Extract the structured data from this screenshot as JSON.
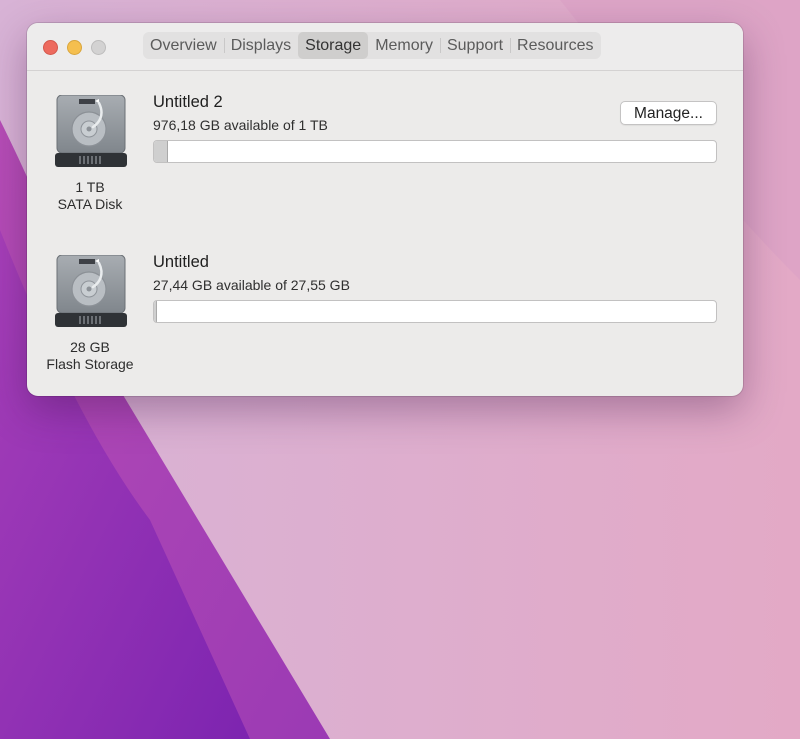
{
  "tabs": [
    {
      "label": "Overview",
      "active": false
    },
    {
      "label": "Displays",
      "active": false
    },
    {
      "label": "Storage",
      "active": true
    },
    {
      "label": "Memory",
      "active": false
    },
    {
      "label": "Support",
      "active": false
    },
    {
      "label": "Resources",
      "active": false
    }
  ],
  "drives": [
    {
      "icon": "hard-drive-icon",
      "size": "1 TB",
      "type": "SATA Disk",
      "volume_name": "Untitled 2",
      "available_text": "976,18 GB available of 1 TB",
      "used_fraction": 0.024,
      "manage_label": "Manage..."
    },
    {
      "icon": "hard-drive-icon",
      "size": "28 GB",
      "type": "Flash Storage",
      "volume_name": "Untitled",
      "available_text": "27,44 GB available of 27,55 GB",
      "used_fraction": 0.004
    }
  ],
  "colors": {
    "close": "#ed6a5e",
    "minimize": "#f5bf4f",
    "zoom": "#d3d2d2",
    "window": "#ecebea"
  }
}
